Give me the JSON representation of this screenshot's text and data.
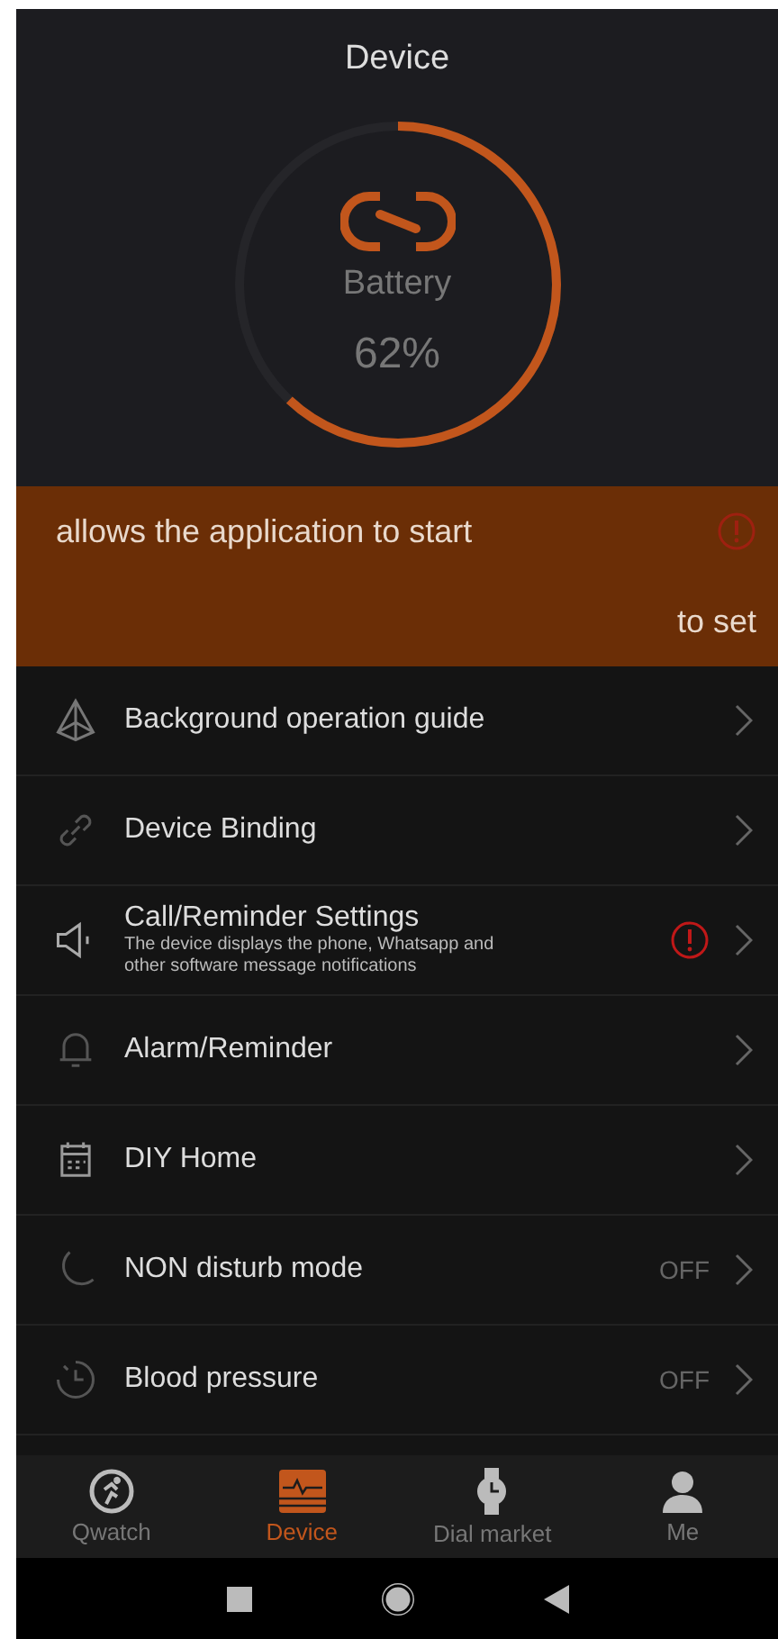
{
  "header": {
    "title": "Device"
  },
  "battery": {
    "label": "Battery",
    "reading": "62%",
    "level": 0.62
  },
  "banner": {
    "text": "allows the application to start",
    "action": "to set",
    "warning": true
  },
  "settings": [
    {
      "title": "Background operation guide",
      "warning": false
    },
    {
      "title": "Device Binding",
      "warning": false
    },
    {
      "title": "Call/Reminder Settings",
      "subtitle": "The device displays the phone, Whatsapp and other software message notifications",
      "warning": true
    },
    {
      "title": "Alarm/Reminder",
      "warning": false
    },
    {
      "title": "DIY Home",
      "warning": false
    },
    {
      "title": "NON disturb mode",
      "value": "OFF",
      "warning": false
    },
    {
      "title": "Blood pressure",
      "value": "OFF",
      "warning": false
    }
  ],
  "tabs": [
    {
      "label": "Qwatch",
      "selected": false
    },
    {
      "label": "Device",
      "selected": true
    },
    {
      "label": "Dial market",
      "selected": false
    },
    {
      "label": "Me",
      "selected": false
    }
  ]
}
